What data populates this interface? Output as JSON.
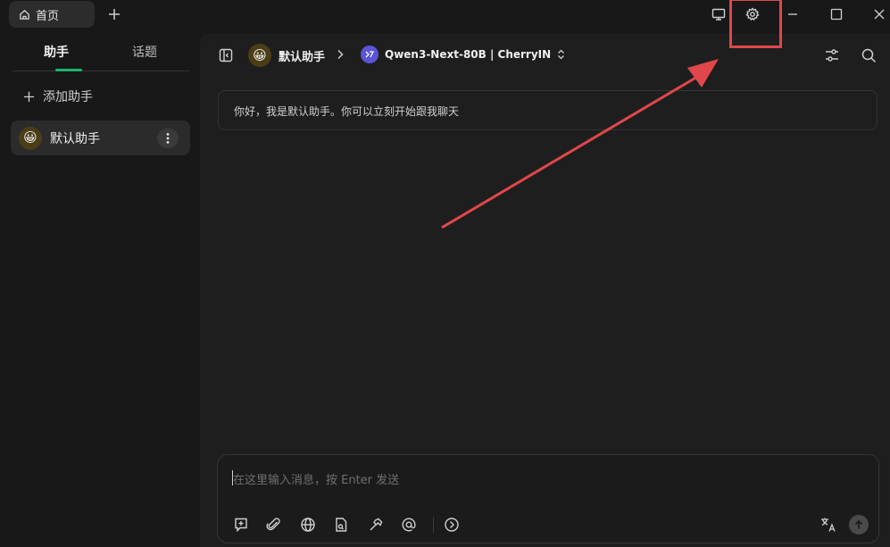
{
  "titlebar": {
    "tab_home_label": "首页"
  },
  "sidebar": {
    "tabs": [
      {
        "label": "助手"
      },
      {
        "label": "话题"
      }
    ],
    "add_assistant_label": "添加助手",
    "assistant": {
      "name": "默认助手",
      "avatar": "😀"
    }
  },
  "main": {
    "assistant_crumb": "默认助手",
    "assistant_avatar": "😀",
    "model_label": "Qwen3-Next-80B | CherryIN",
    "welcome_text": "你好，我是默认助手。你可以立刻开始跟我聊天",
    "input_placeholder": "在这里输入消息，按 Enter 发送"
  },
  "colors": {
    "accent": "#18b56a",
    "annotation": "#e0474a",
    "model_logo": "#5a55d6"
  }
}
